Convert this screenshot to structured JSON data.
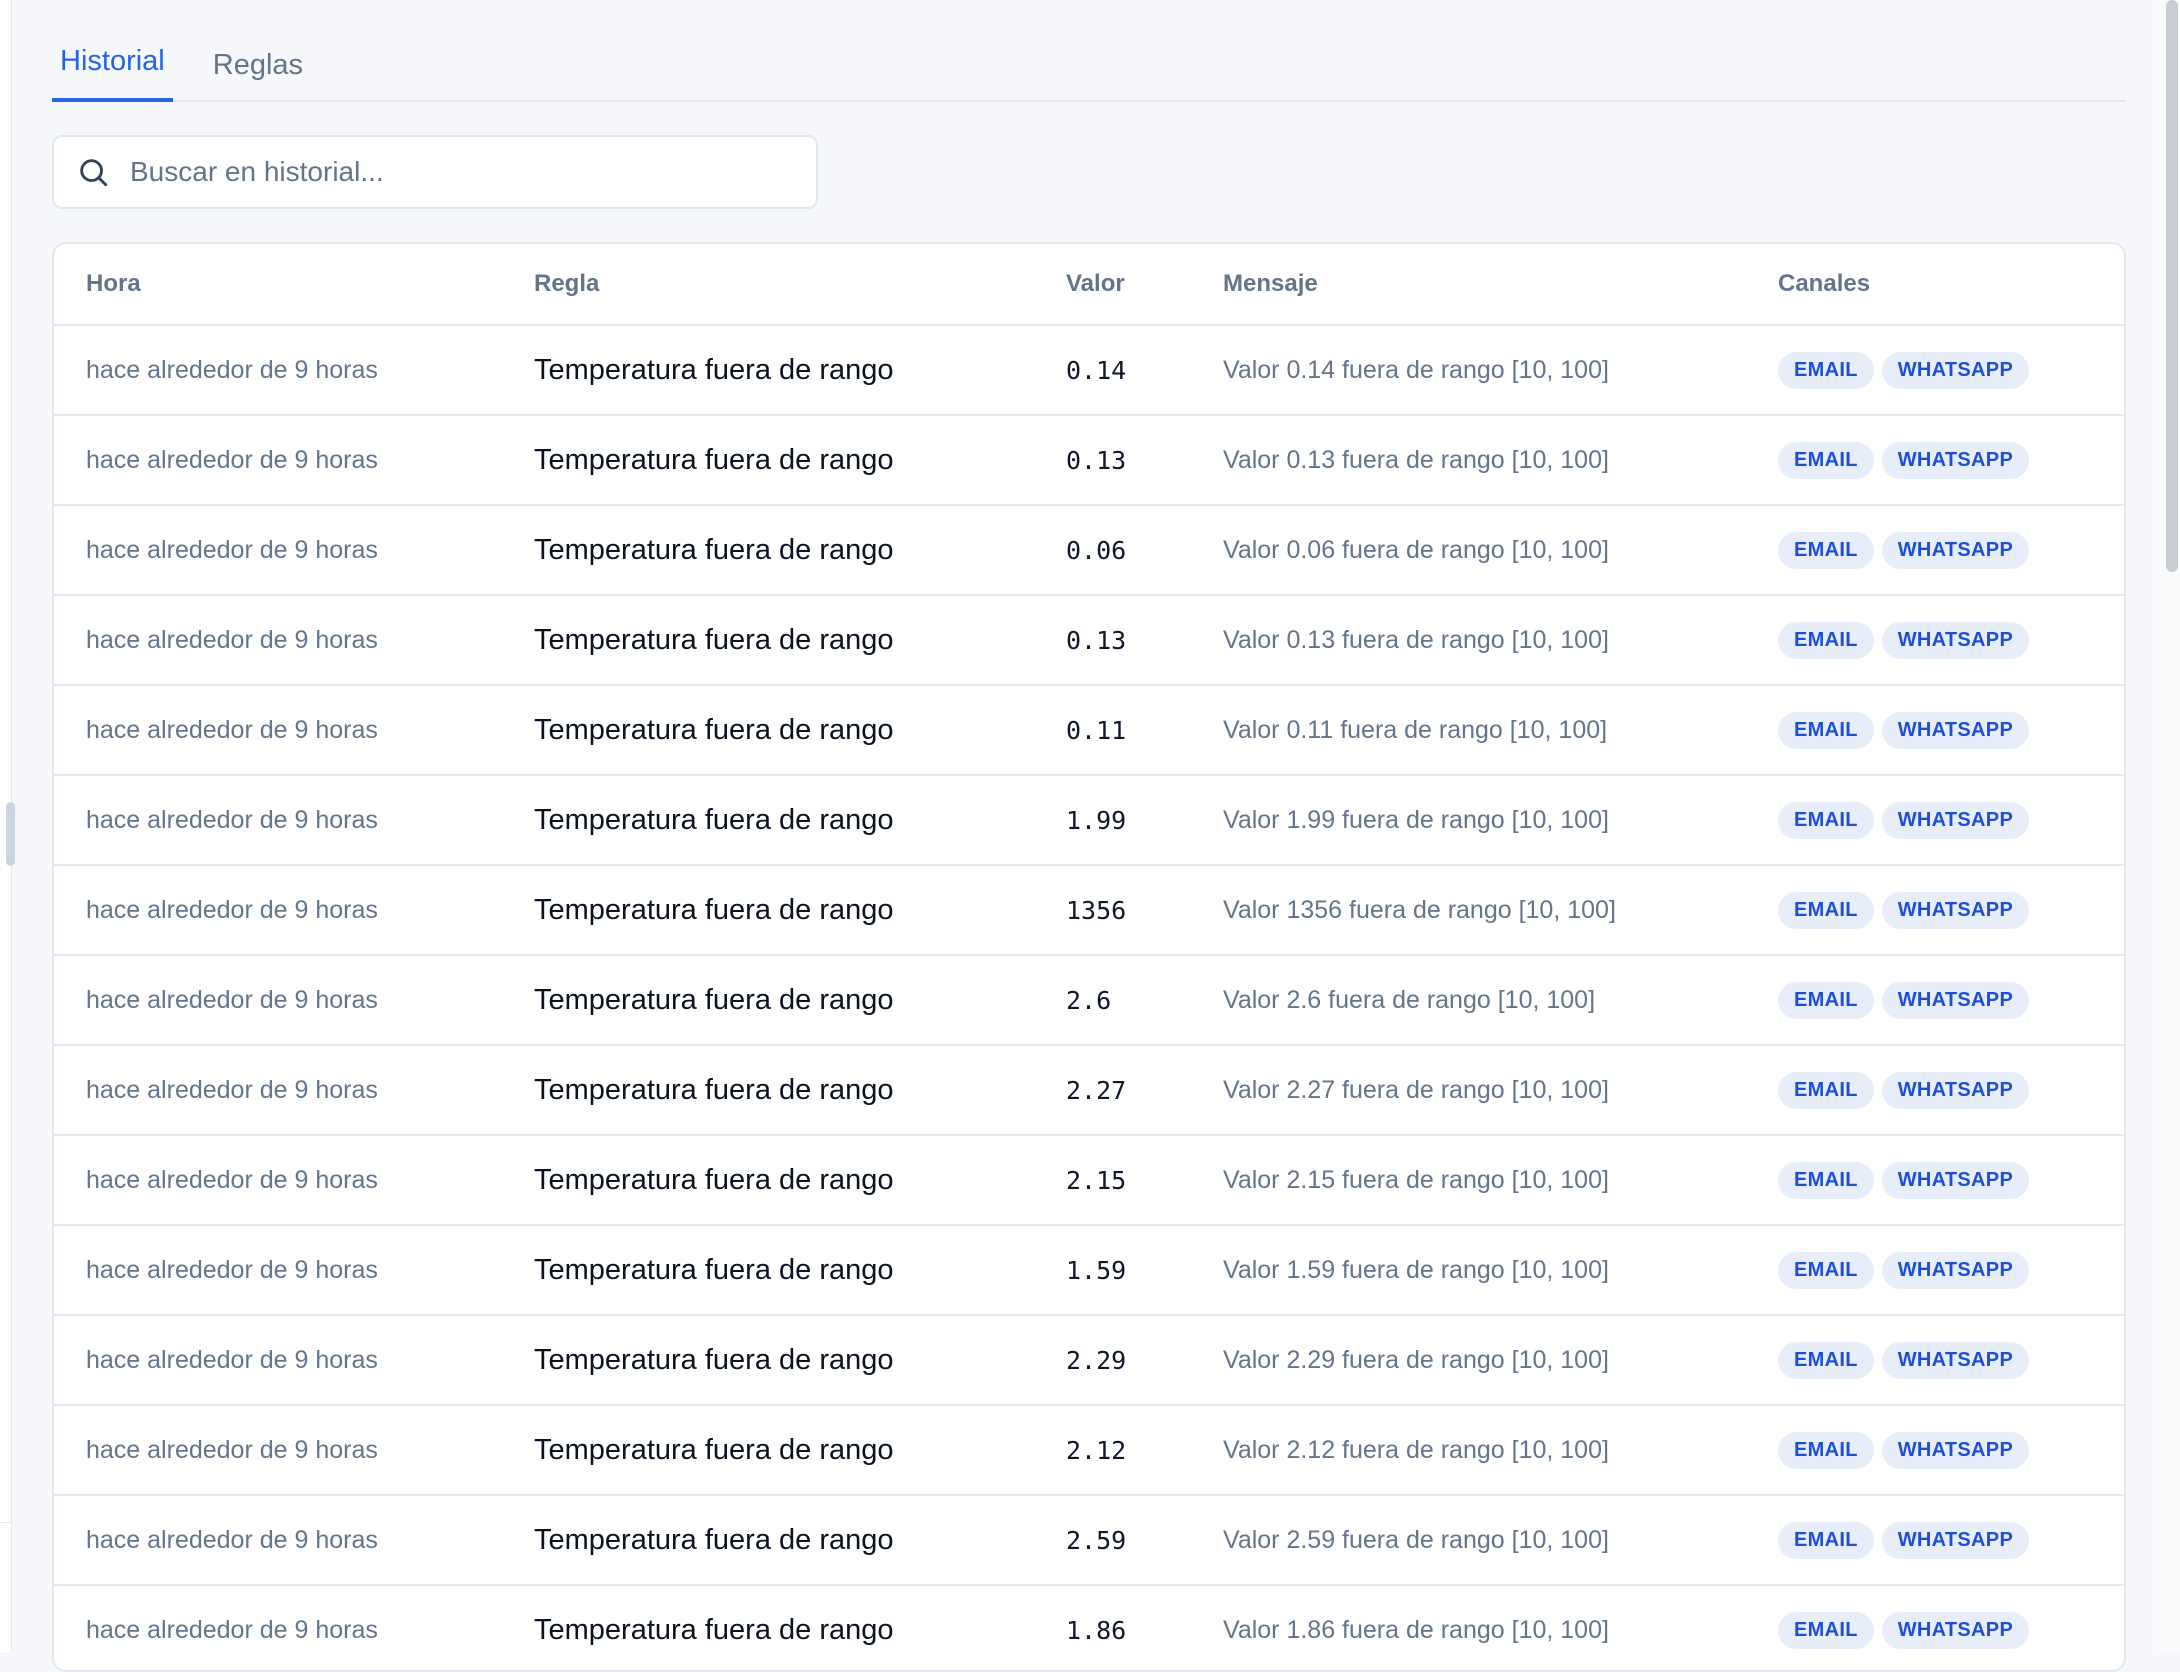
{
  "tabs": [
    {
      "label": "Historial",
      "active": true
    },
    {
      "label": "Reglas",
      "active": false
    }
  ],
  "search": {
    "placeholder": "Buscar en historial...",
    "icon": "search-icon"
  },
  "table": {
    "headers": [
      "Hora",
      "Regla",
      "Valor",
      "Mensaje",
      "Canales"
    ],
    "rows": [
      {
        "hora": "hace alrededor de 9 horas",
        "regla": "Temperatura fuera de rango",
        "valor": "0.14",
        "mensaje": "Valor 0.14 fuera de rango [10, 100]",
        "canales": [
          "EMAIL",
          "WHATSAPP"
        ]
      },
      {
        "hora": "hace alrededor de 9 horas",
        "regla": "Temperatura fuera de rango",
        "valor": "0.13",
        "mensaje": "Valor 0.13 fuera de rango [10, 100]",
        "canales": [
          "EMAIL",
          "WHATSAPP"
        ]
      },
      {
        "hora": "hace alrededor de 9 horas",
        "regla": "Temperatura fuera de rango",
        "valor": "0.06",
        "mensaje": "Valor 0.06 fuera de rango [10, 100]",
        "canales": [
          "EMAIL",
          "WHATSAPP"
        ]
      },
      {
        "hora": "hace alrededor de 9 horas",
        "regla": "Temperatura fuera de rango",
        "valor": "0.13",
        "mensaje": "Valor 0.13 fuera de rango [10, 100]",
        "canales": [
          "EMAIL",
          "WHATSAPP"
        ]
      },
      {
        "hora": "hace alrededor de 9 horas",
        "regla": "Temperatura fuera de rango",
        "valor": "0.11",
        "mensaje": "Valor 0.11 fuera de rango [10, 100]",
        "canales": [
          "EMAIL",
          "WHATSAPP"
        ]
      },
      {
        "hora": "hace alrededor de 9 horas",
        "regla": "Temperatura fuera de rango",
        "valor": "1.99",
        "mensaje": "Valor 1.99 fuera de rango [10, 100]",
        "canales": [
          "EMAIL",
          "WHATSAPP"
        ]
      },
      {
        "hora": "hace alrededor de 9 horas",
        "regla": "Temperatura fuera de rango",
        "valor": "1356",
        "mensaje": "Valor 1356 fuera de rango [10, 100]",
        "canales": [
          "EMAIL",
          "WHATSAPP"
        ]
      },
      {
        "hora": "hace alrededor de 9 horas",
        "regla": "Temperatura fuera de rango",
        "valor": "2.6",
        "mensaje": "Valor 2.6 fuera de rango [10, 100]",
        "canales": [
          "EMAIL",
          "WHATSAPP"
        ]
      },
      {
        "hora": "hace alrededor de 9 horas",
        "regla": "Temperatura fuera de rango",
        "valor": "2.27",
        "mensaje": "Valor 2.27 fuera de rango [10, 100]",
        "canales": [
          "EMAIL",
          "WHATSAPP"
        ]
      },
      {
        "hora": "hace alrededor de 9 horas",
        "regla": "Temperatura fuera de rango",
        "valor": "2.15",
        "mensaje": "Valor 2.15 fuera de rango [10, 100]",
        "canales": [
          "EMAIL",
          "WHATSAPP"
        ]
      },
      {
        "hora": "hace alrededor de 9 horas",
        "regla": "Temperatura fuera de rango",
        "valor": "1.59",
        "mensaje": "Valor 1.59 fuera de rango [10, 100]",
        "canales": [
          "EMAIL",
          "WHATSAPP"
        ]
      },
      {
        "hora": "hace alrededor de 9 horas",
        "regla": "Temperatura fuera de rango",
        "valor": "2.29",
        "mensaje": "Valor 2.29 fuera de rango [10, 100]",
        "canales": [
          "EMAIL",
          "WHATSAPP"
        ]
      },
      {
        "hora": "hace alrededor de 9 horas",
        "regla": "Temperatura fuera de rango",
        "valor": "2.12",
        "mensaje": "Valor 2.12 fuera de rango [10, 100]",
        "canales": [
          "EMAIL",
          "WHATSAPP"
        ]
      },
      {
        "hora": "hace alrededor de 9 horas",
        "regla": "Temperatura fuera de rango",
        "valor": "2.59",
        "mensaje": "Valor 2.59 fuera de rango [10, 100]",
        "canales": [
          "EMAIL",
          "WHATSAPP"
        ]
      },
      {
        "hora": "hace alrededor de 9 horas",
        "regla": "Temperatura fuera de rango",
        "valor": "1.86",
        "mensaje": "Valor 1.86 fuera de rango [10, 100]",
        "canales": [
          "EMAIL",
          "WHATSAPP"
        ]
      }
    ]
  },
  "colors": {
    "accent": "#2563eb",
    "badge_bg": "#e8eef9",
    "badge_text": "#1d4ed8",
    "muted_text": "#64748b",
    "background": "#f6f8fb"
  }
}
